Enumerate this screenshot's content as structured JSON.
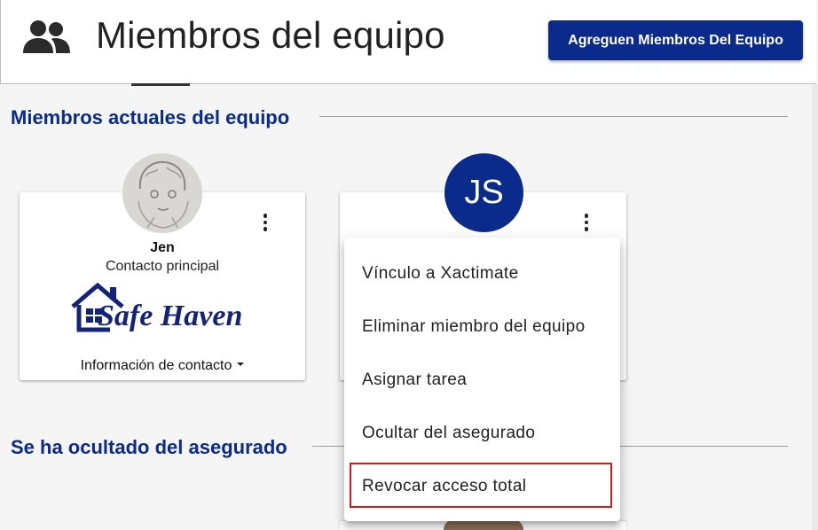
{
  "header": {
    "title": "Miembros del equipo",
    "add_button_label": "Agreguen Miembros Del Equipo",
    "icon": "team-icon"
  },
  "sections": {
    "current_title": "Miembros actuales del equipo",
    "hidden_title": "Se ha ocultado del asegurado"
  },
  "members": [
    {
      "name": "Jen",
      "role": "Contacto principal",
      "contact_label": "Información de contacto",
      "logo_text": "Safe Haven",
      "avatar": "photo"
    },
    {
      "initials": "JS",
      "avatar_color": "#0a2a8c"
    }
  ],
  "menu": {
    "items": [
      "Vínculo a Xactimate",
      "Eliminar miembro del equipo",
      "Asignar tarea",
      "Ocultar del asegurado",
      "Revocar acceso total"
    ],
    "highlighted_index": 4
  },
  "colors": {
    "brand": "#0a2a8c",
    "highlight": "#d01c1f"
  }
}
